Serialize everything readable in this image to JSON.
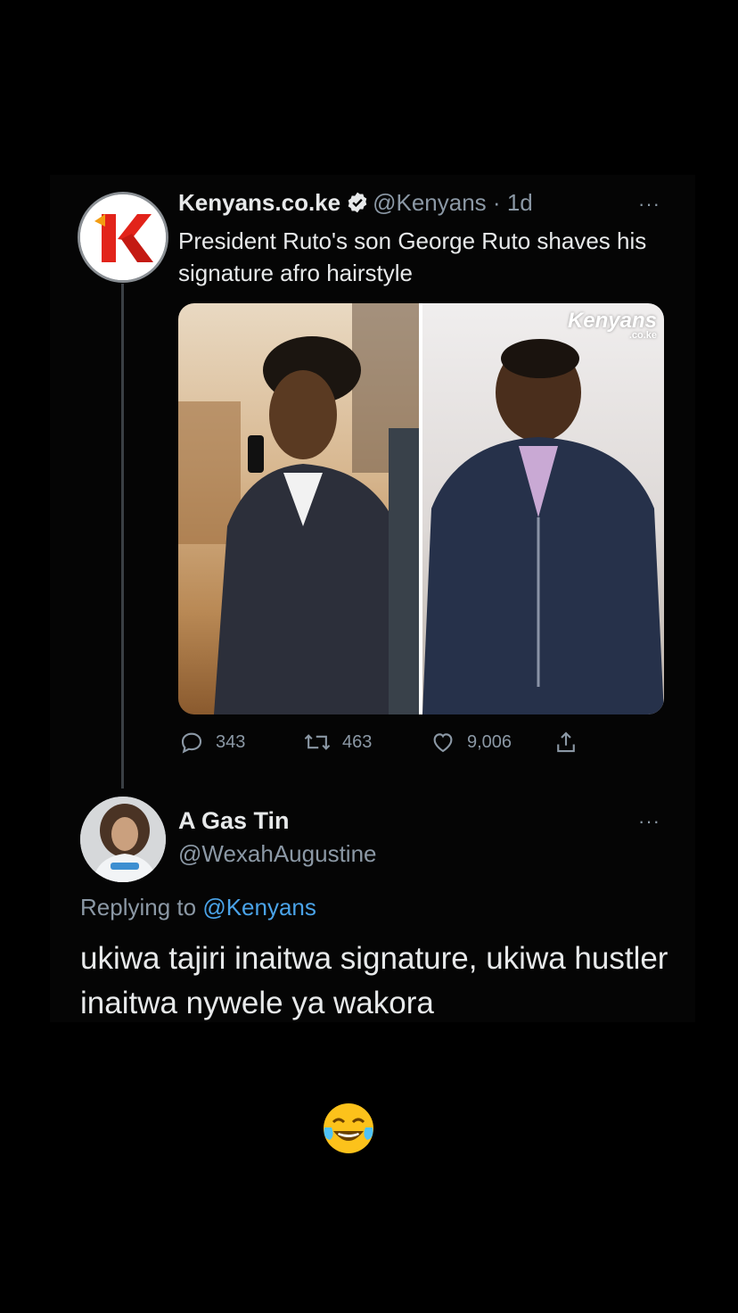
{
  "tweet": {
    "author_name": "Kenyans.co.ke",
    "author_handle": "@Kenyans",
    "separator": "·",
    "time": "1d",
    "avatar_icon": "kenyans-logo-icon",
    "text": "President Ruto's son George Ruto shaves his signature afro hairstyle",
    "media": {
      "watermark": "Kenyans",
      "watermark_sub": ".co.ke"
    },
    "stats": {
      "replies": "343",
      "retweets": "463",
      "likes": "9,006"
    },
    "more_label": "···"
  },
  "reply": {
    "author_name": "A Gas Tin",
    "author_handle": "@WexahAugustine",
    "replying_prefix": "Replying to",
    "replying_mention": "@Kenyans",
    "text": "ukiwa tajiri inaitwa signature, ukiwa hustler inaitwa nywele ya wakora",
    "more_label": "···"
  },
  "caption_emoji": "face-with-tears-of-joy-icon",
  "colors": {
    "background": "#000000",
    "text_primary": "#e7e9ea",
    "text_secondary": "#8b98a5",
    "link": "#4aa3e8",
    "verified": "#e7e9ea",
    "kenyans_red": "#e2231a"
  }
}
